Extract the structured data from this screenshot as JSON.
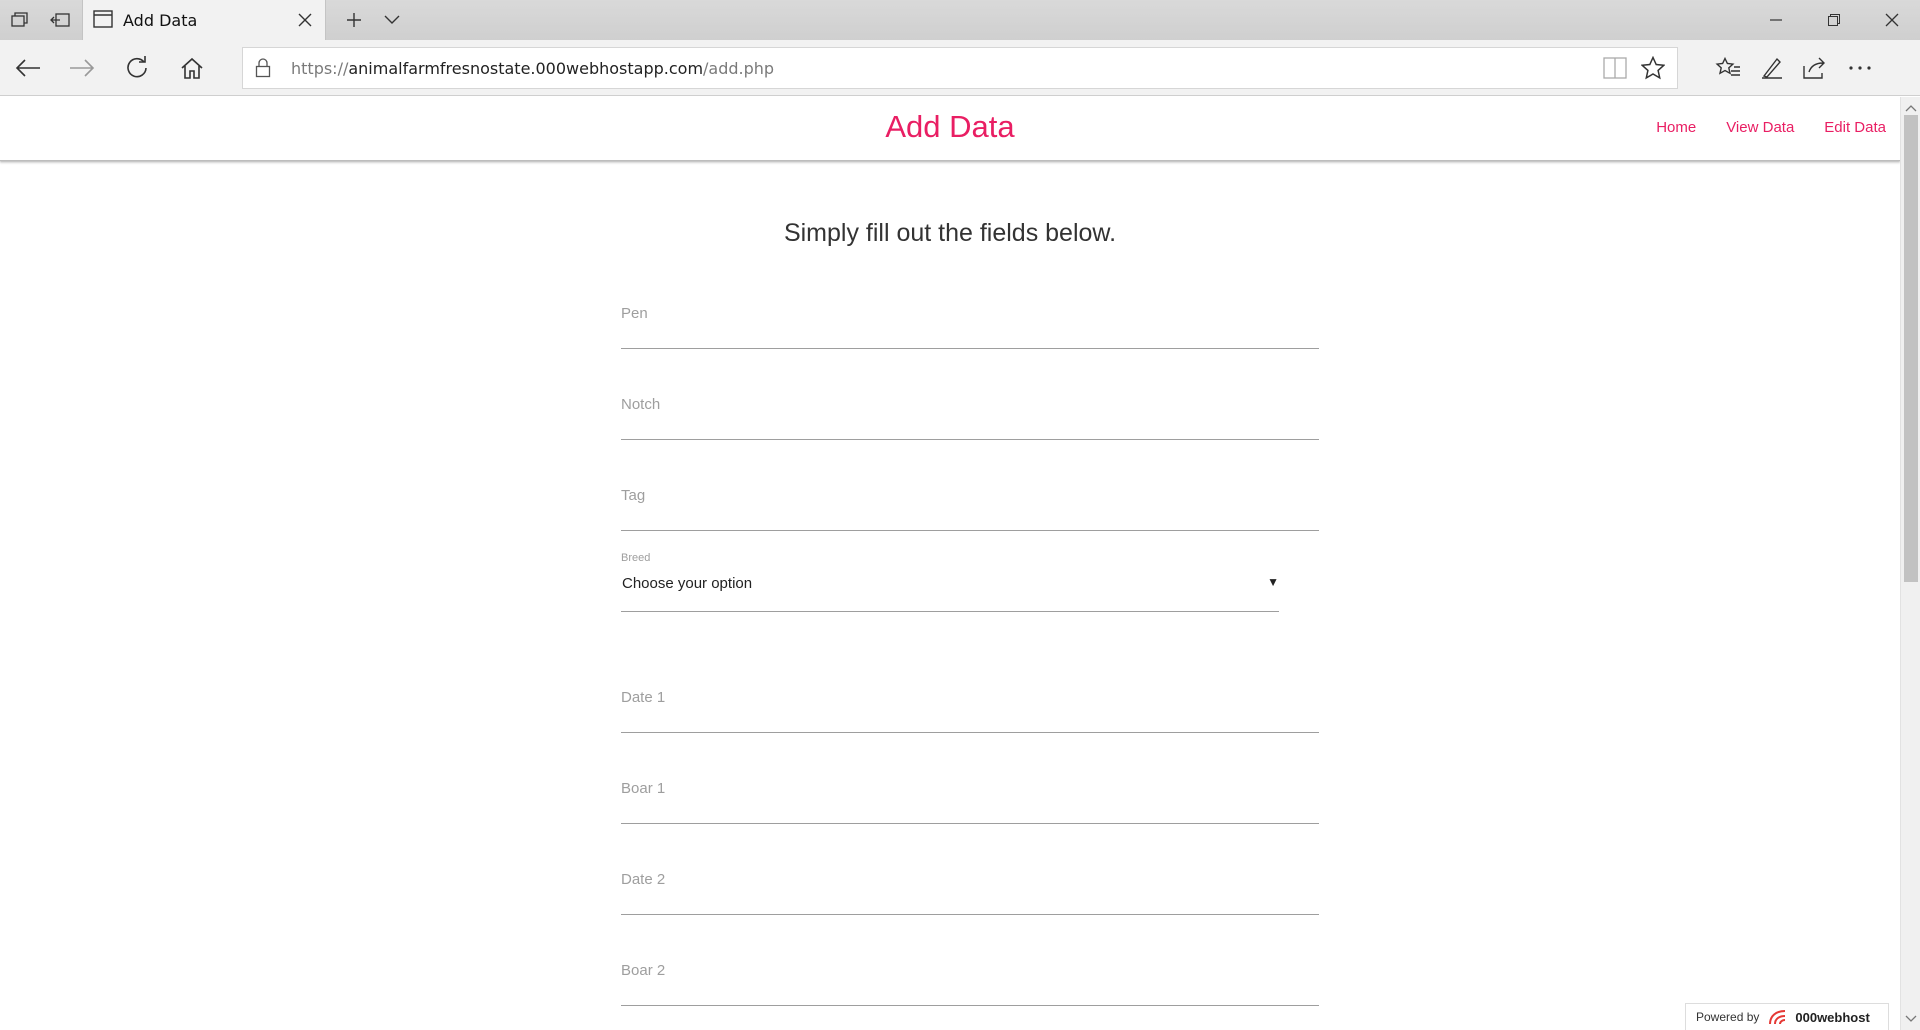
{
  "browser": {
    "tab_title": "Add Data",
    "url_protocol": "https://",
    "url_host": "animalfarmfresnostate.000webhostapp.com",
    "url_path": "/add.php"
  },
  "site": {
    "brand": "Add Data",
    "nav": [
      "Home",
      "View Data",
      "Edit Data"
    ],
    "accent_color": "#e91e63"
  },
  "form": {
    "intro": "Simply fill out the fields below.",
    "fields": {
      "pen": "Pen",
      "notch": "Notch",
      "tag": "Tag",
      "date1": "Date 1",
      "boar1": "Boar 1",
      "date2": "Date 2",
      "boar2": "Boar 2"
    },
    "breed": {
      "label": "Breed",
      "value": "Choose your option"
    }
  },
  "footer": {
    "powered_by": "Powered by",
    "host_name": "000webhost"
  }
}
